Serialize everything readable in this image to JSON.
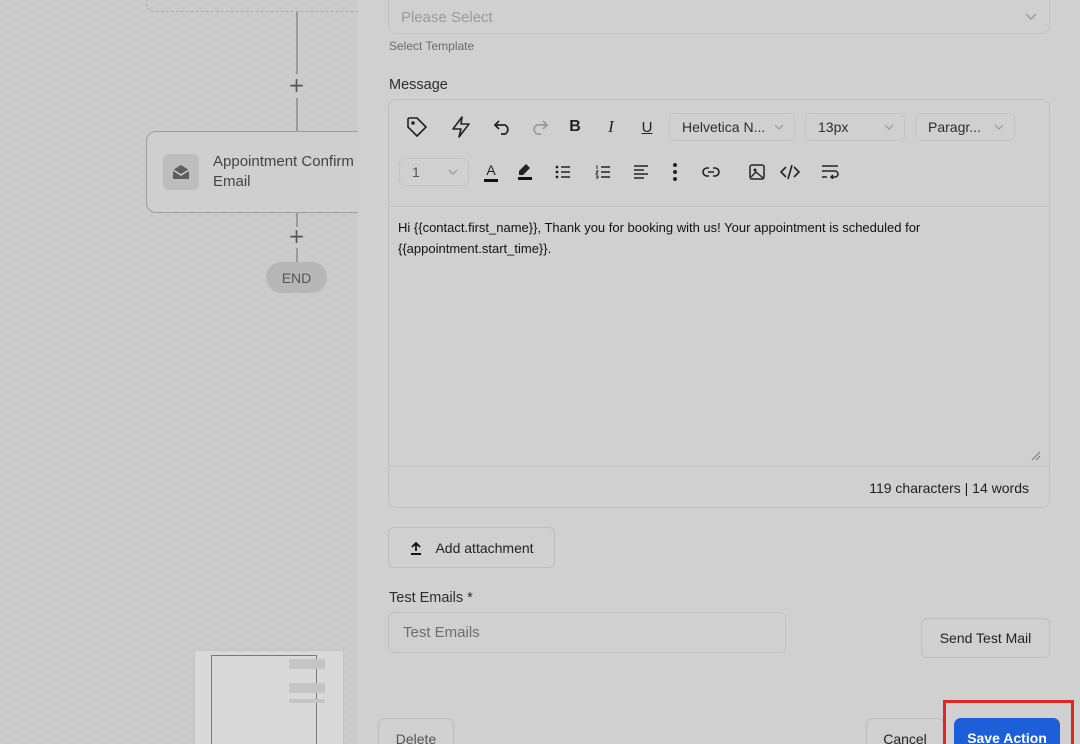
{
  "canvas": {
    "node": {
      "title_line1": "Appointment Confirm",
      "title_line2": "Email",
      "icon": "envelope-open-icon"
    },
    "add_step_symbol": "+",
    "end_label": "END"
  },
  "form": {
    "template_select": {
      "placeholder": "Please Select",
      "helper": "Select Template"
    },
    "message_label": "Message",
    "toolbar": {
      "font_family": "Helvetica N...",
      "font_size": "13px",
      "block_format": "Paragr...",
      "line_height": "1",
      "icons": [
        "tag-icon",
        "lightning-icon",
        "undo-icon",
        "redo-icon",
        "bold-icon",
        "italic-icon",
        "underline-icon",
        "text-color-icon",
        "highlight-icon",
        "bullet-list-icon",
        "numbered-list-icon",
        "align-icon",
        "more-vertical-icon",
        "link-icon",
        "image-icon",
        "code-icon",
        "text-wrap-icon"
      ],
      "bold_glyph": "B",
      "italic_glyph": "I",
      "underline_glyph": "U",
      "text_color_glyph": "A"
    },
    "message_body": "Hi {{contact.first_name}}, Thank you for booking with us! Your appointment is scheduled for {{appointment.start_time}}.",
    "counter": "119 characters | 14 words",
    "add_attachment_label": "Add attachment",
    "test_emails_label": "Test Emails *",
    "test_emails_placeholder": "Test Emails",
    "send_test_label": "Send Test Mail"
  },
  "footer": {
    "delete_label": "Delete",
    "cancel_label": "Cancel",
    "save_label": "Save Action"
  },
  "colors": {
    "primary": "#1d5fd8",
    "highlight": "#e0261f"
  }
}
